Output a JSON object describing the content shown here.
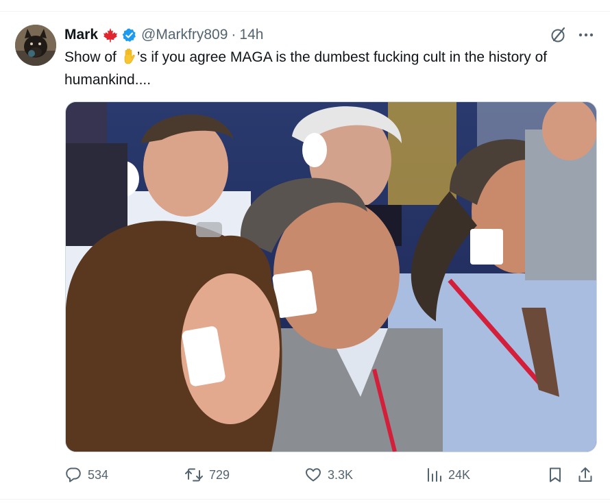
{
  "tweet": {
    "author_name": "Mark",
    "flag_icon": "maple-leaf-icon",
    "verified_icon": "verified-badge-icon",
    "handle": "@Markfry809",
    "separator": "·",
    "time": "14h",
    "text_before_emoji": "Show of ",
    "emoji": "raised-hand-icon",
    "text_after_emoji": "’s if you agree MAGA is the dumbest fucking cult in the history of humankind...."
  },
  "top_actions": {
    "grok_icon": "grok-icon",
    "more_icon": "more-icon"
  },
  "media": {
    "type": "photo"
  },
  "actions": {
    "replies": "534",
    "reposts": "729",
    "likes": "3.3K",
    "views": "24K"
  },
  "colors": {
    "text": "#0f1419",
    "secondary": "#536471",
    "verified_blue": "#1d9bf0",
    "flag_red": "#e0262e",
    "divider": "#eff3f4"
  }
}
